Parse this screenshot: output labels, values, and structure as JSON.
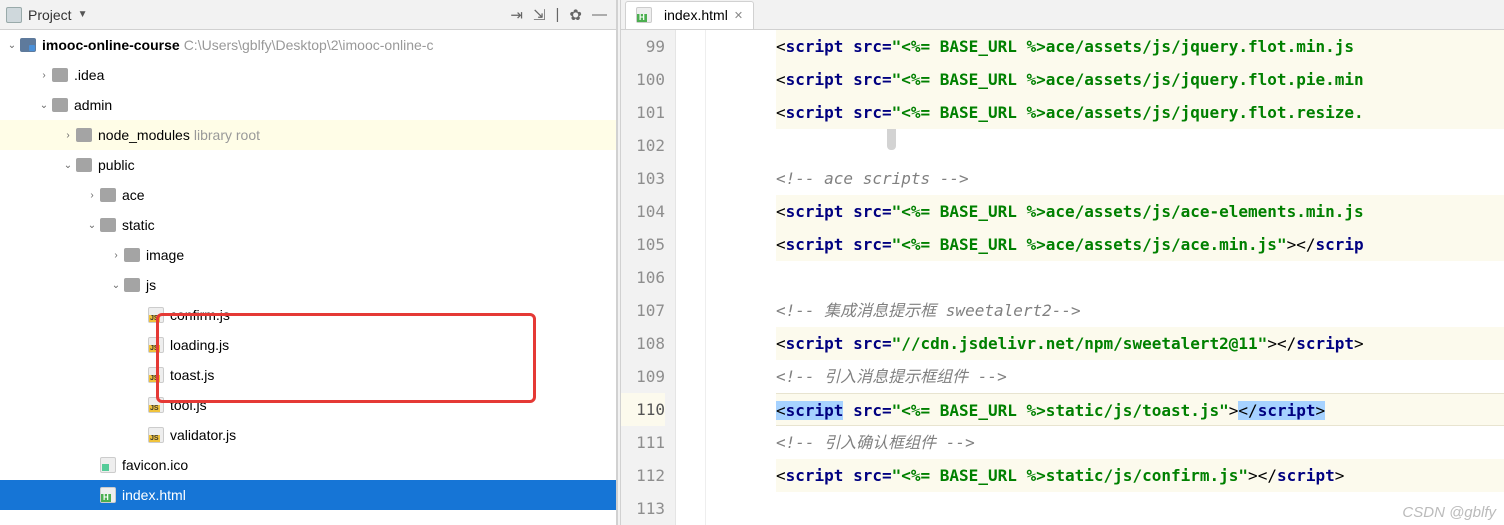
{
  "toolbar": {
    "title": "Project"
  },
  "tree": {
    "root_name": "imooc-online-course",
    "root_path": "C:\\Users\\gblfy\\Desktop\\2\\imooc-online-c",
    "idea": ".idea",
    "admin": "admin",
    "node_modules": "node_modules",
    "node_modules_hint": "library root",
    "public": "public",
    "ace": "ace",
    "static": "static",
    "image": "image",
    "js": "js",
    "confirm": "confirm.js",
    "loading": "loading.js",
    "toast": "toast.js",
    "tool": "tool.js",
    "validator": "validator.js",
    "favicon": "favicon.ico",
    "index": "index.html"
  },
  "tabs": {
    "index": "index.html"
  },
  "gutter": [
    "99",
    "100",
    "101",
    "102",
    "103",
    "104",
    "105",
    "106",
    "107",
    "108",
    "109",
    "110",
    "111",
    "112",
    "113"
  ],
  "code": {
    "l99_pre": "<",
    "l99_tag": "script",
    "l99_sp": " ",
    "l99_attr": "src=",
    "l99_q": "\"",
    "l99_str": "<%= BASE_URL %>ace/assets/js/jquery.flot.min.js",
    "l100_pre": "<",
    "l100_tag": "script",
    "l100_attr": "src=",
    "l100_q": "\"",
    "l100_str": "<%= BASE_URL %>ace/assets/js/jquery.flot.pie.min",
    "l101_pre": "<",
    "l101_tag": "script",
    "l101_attr": "src=",
    "l101_q": "\"",
    "l101_str": "<%= BASE_URL %>ace/assets/js/jquery.flot.resize.",
    "l103_comment": "<!-- ace scripts -->",
    "l104_pre": "<",
    "l104_tag": "script",
    "l104_attr": "src=",
    "l104_q": "\"",
    "l104_str": "<%= BASE_URL %>ace/assets/js/ace-elements.min.js",
    "l105_pre": "<",
    "l105_tag": "script",
    "l105_attr": "src=",
    "l105_q": "\"",
    "l105_str": "<%= BASE_URL %>ace/assets/js/ace.min.js",
    "l105_q2": "\"",
    "l105_gt": ">",
    "l105_close": "</",
    "l105_ctag": "scrip",
    "l107_comment": "<!--  集成消息提示框 sweetalert2-->",
    "l108_pre": "<",
    "l108_tag": "script",
    "l108_attr": "src=",
    "l108_q": "\"",
    "l108_str": "//cdn.jsdelivr.net/npm/sweetalert2@11",
    "l108_q2": "\"",
    "l108_gt": ">",
    "l108_close": "</",
    "l108_ctag": "script",
    "l108_cgt": ">",
    "l109_comment": "<!-- 引入消息提示框组件       -->",
    "l110_pre": "<",
    "l110_tag": "script",
    "l110_attr": "src=",
    "l110_q": "\"",
    "l110_str": "<%= BASE_URL %>static/js/toast.js",
    "l110_q2": "\"",
    "l110_gt": ">",
    "l110_close": "</",
    "l110_ctag": "script",
    "l110_cgt": ">",
    "l111_comment": "<!-- 引入确认框组件       -->",
    "l112_pre": "<",
    "l112_tag": "script",
    "l112_attr": "src=",
    "l112_q": "\"",
    "l112_str": "<%= BASE_URL %>static/js/confirm.js",
    "l112_q2": "\"",
    "l112_gt": ">",
    "l112_close": "</",
    "l112_ctag": "script",
    "l112_cgt": ">"
  },
  "watermark": "CSDN @gblfy"
}
